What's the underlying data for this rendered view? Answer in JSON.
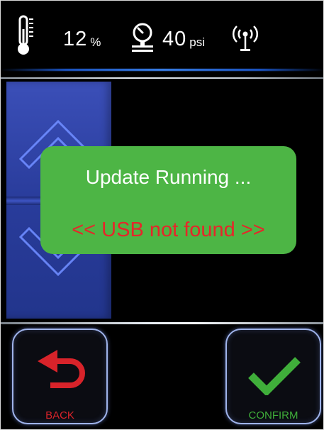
{
  "status_bar": {
    "temperature": {
      "value": "12",
      "unit": "%"
    },
    "pressure": {
      "value": "40",
      "unit": "psi"
    },
    "icons": [
      "thermometer-icon",
      "pressure-gauge-icon",
      "wireless-signal-icon"
    ]
  },
  "dialog": {
    "title": "Update Running ...",
    "error": "<< USB not found >>"
  },
  "buttons": {
    "back": {
      "label": "BACK",
      "icon": "undo-arrow-icon"
    },
    "confirm": {
      "label": "CONFIRM",
      "icon": "checkmark-icon"
    }
  },
  "slider": {
    "icons": [
      "chevron-up-icon",
      "chevron-down-icon"
    ]
  },
  "colors": {
    "background": "#000000",
    "dialog": "#4db545",
    "error_text": "#e6262a",
    "back": "#d8232a",
    "confirm": "#3fae3a",
    "slider": "#2e42a6",
    "button_border": "#9fb3ea"
  }
}
